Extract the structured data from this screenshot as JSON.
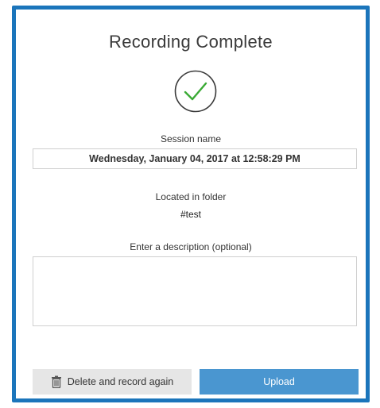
{
  "dialog": {
    "title": "Recording Complete",
    "check_icon": "check-circle-icon",
    "accent_color": "#1b75bb",
    "check_color": "#3aaa35"
  },
  "session": {
    "label": "Session name",
    "value": "Wednesday, January 04, 2017 at 12:58:29 PM"
  },
  "folder": {
    "label": "Located in folder",
    "value": "#test"
  },
  "description": {
    "label": "Enter a description (optional)",
    "value": ""
  },
  "actions": {
    "delete_label": "Delete and record again",
    "delete_icon": "trash-icon",
    "upload_label": "Upload",
    "upload_color": "#4a96d0"
  }
}
